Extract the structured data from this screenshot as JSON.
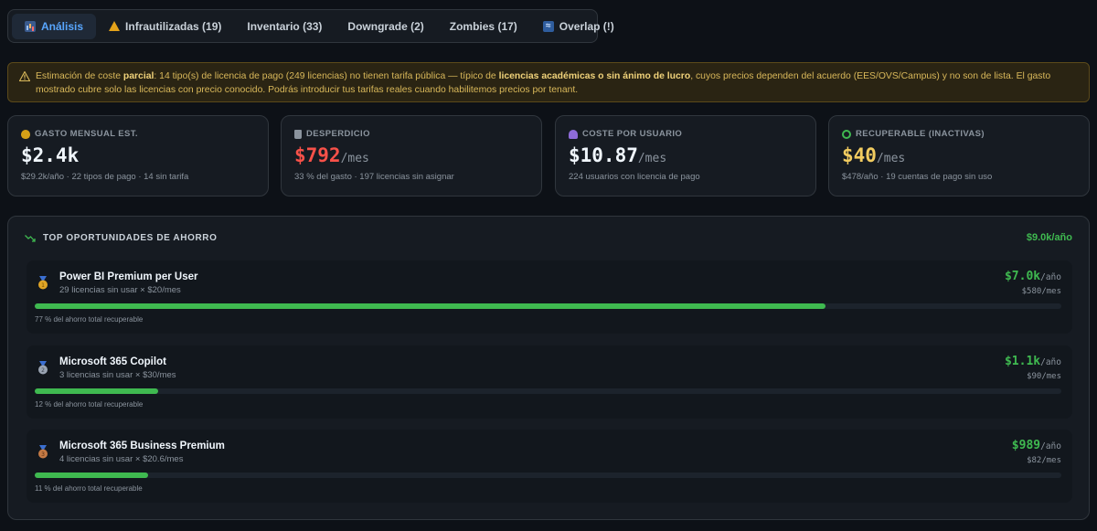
{
  "tabs": [
    {
      "label": "Análisis",
      "icon": "chart-icon",
      "active": true
    },
    {
      "label": "Infrautilizadas (19)",
      "icon": "warning-icon"
    },
    {
      "label": "Inventario (33)",
      "icon": ""
    },
    {
      "label": "Downgrade (2)",
      "icon": ""
    },
    {
      "label": "Zombies (17)",
      "icon": ""
    },
    {
      "label": "Overlap (!)",
      "icon": "overlap-icon"
    }
  ],
  "banner": {
    "part1": "Estimación de coste ",
    "bold1": "parcial",
    "part2": ": 14 tipo(s) de licencia de pago (249 licencias) no tienen tarifa pública — típico de ",
    "bold2": "licencias académicas o sin ánimo de lucro",
    "part3": ", cuyos precios dependen del acuerdo (EES/OVS/Campus) y no son de lista. El gasto mostrado cubre solo las licencias con precio conocido. Podrás introducir tus tarifas reales cuando habilitemos precios por tenant."
  },
  "cards": [
    {
      "label": "GASTO MENSUAL EST.",
      "value": "$2.4k",
      "unit": "",
      "sub": "$29.2k/año · 22 tipos de pago · 14 sin tarifa",
      "value_color": "#f0f6fc",
      "icon": "money-bag-icon",
      "icon_color": "#d4a017"
    },
    {
      "label": "DESPERDICIO",
      "value": "$792",
      "unit": "/mes",
      "sub": "33 % del gasto · 197 licencias sin asignar",
      "value_color": "#f85149",
      "icon": "trash-icon",
      "icon_color": "#8b949e"
    },
    {
      "label": "COSTE POR USUARIO",
      "value": "$10.87",
      "unit": "/mes",
      "sub": "224 usuarios con licencia de pago",
      "value_color": "#f0f6fc",
      "icon": "user-icon",
      "icon_color": "#8e6bd8"
    },
    {
      "label": "RECUPERABLE (INACTIVAS)",
      "value": "$40",
      "unit": "/mes",
      "sub": "$478/año · 19 cuentas de pago sin uso",
      "value_color": "#f2cc60",
      "icon": "recycle-icon",
      "icon_color": "#3fb950"
    }
  ],
  "opportunities": {
    "title": "TOP OPORTUNIDADES DE AHORRO",
    "total": "$9.0k/año",
    "items": [
      {
        "name": "Power BI Premium per User",
        "detail": "29 licencias sin usar × $20/mes",
        "amount": "$7.0k",
        "amount_unit": "/año",
        "monthly": "$580/mes",
        "share": 0.77,
        "pct_label": "77 % del ahorro total recuperable",
        "medal": "gold-medal-icon",
        "medal_color": "#e0a526"
      },
      {
        "name": "Microsoft 365 Copilot",
        "detail": "3 licencias sin usar × $30/mes",
        "amount": "$1.1k",
        "amount_unit": "/año",
        "monthly": "$90/mes",
        "share": 0.12,
        "pct_label": "12 % del ahorro total recuperable",
        "medal": "silver-medal-icon",
        "medal_color": "#9aa4b2"
      },
      {
        "name": "Microsoft 365 Business Premium",
        "detail": "4 licencias sin usar × $20.6/mes",
        "amount": "$989",
        "amount_unit": "/año",
        "monthly": "$82/mes",
        "share": 0.11,
        "pct_label": "11 % del ahorro total recuperable",
        "medal": "bronze-medal-icon",
        "medal_color": "#c47a45"
      }
    ]
  }
}
